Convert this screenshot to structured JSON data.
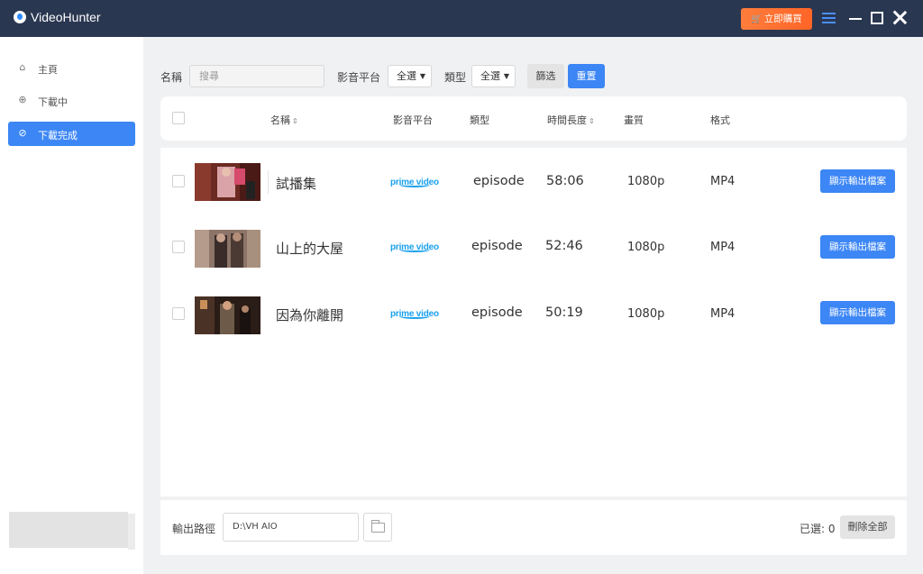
{
  "app": {
    "title": "VideoHunter",
    "buy_label": "立即購買",
    "accent": "#3c86f5",
    "buy_color": "#ff6d2c",
    "titlebar_color": "#2a3751"
  },
  "window_controls": [
    "menu-icon",
    "minimize-icon",
    "maximize-icon",
    "close-icon"
  ],
  "sidebar": {
    "items": [
      {
        "label": "主頁",
        "icon": "home-icon"
      },
      {
        "label": "下載中",
        "icon": "download-icon"
      },
      {
        "label": "下載完成",
        "icon": "check-circle-icon",
        "active": true
      }
    ]
  },
  "filters": {
    "name_label": "名稱",
    "search_placeholder": "搜尋",
    "platform_label": "影音平台",
    "platform_value": "全選",
    "type_label": "類型",
    "type_value": "全選",
    "filter_button": "篩选",
    "reset_button": "重置"
  },
  "table": {
    "headers": {
      "name": "名稱",
      "platform": "影音平台",
      "type": "類型",
      "duration": "時間長度",
      "quality": "畫質",
      "format": "格式"
    },
    "rows": [
      {
        "title": "試播集",
        "platform": "prime video",
        "type": "episode",
        "duration": "58:06",
        "quality": "1080p",
        "format": "MP4",
        "action": "顯示輸出檔案"
      },
      {
        "title": "山上的大屋",
        "platform": "prime video",
        "type": "episode",
        "duration": "52:46",
        "quality": "1080p",
        "format": "MP4",
        "action": "顯示輸出檔案"
      },
      {
        "title": "因為你離開",
        "platform": "prime video",
        "type": "episode",
        "duration": "50:19",
        "quality": "1080p",
        "format": "MP4",
        "action": "顯示輸出檔案"
      }
    ]
  },
  "footer": {
    "path_label": "輸出路徑",
    "path_value": "D:\\VH AIO",
    "selected_label": "已選: 0",
    "delete_all": "刪除全部"
  }
}
